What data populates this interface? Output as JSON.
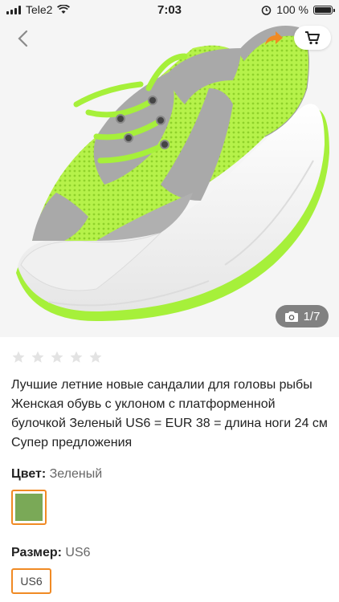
{
  "status_bar": {
    "carrier": "Tele2",
    "time": "7:03",
    "battery": "100 %",
    "battery_level": 1.0
  },
  "nav": {
    "back_icon": "chevron-left-icon",
    "share_icon": "share-arrow-icon",
    "cart_icon": "cart-icon"
  },
  "gallery": {
    "counter": "1/7",
    "current": 1,
    "total": 7
  },
  "product": {
    "rating": 0,
    "rating_max": 5,
    "title": "Лучшие летние новые сандалии для головы рыбы Женская обувь с уклоном с платформенной булочкой Зеленый US6 = EUR 38 = длина ноги 24 см Супер предложения",
    "color_label": "Цвет:",
    "color_value": "Зеленый",
    "swatch_color": "#7aa957",
    "size_label": "Размер:",
    "size_value": "US6",
    "size_option": "US6"
  },
  "colors": {
    "accent": "#f08a24",
    "star_empty": "#e3e3e3",
    "shoe_green": "#a6f03a",
    "shoe_gray": "#a9a9a9"
  }
}
